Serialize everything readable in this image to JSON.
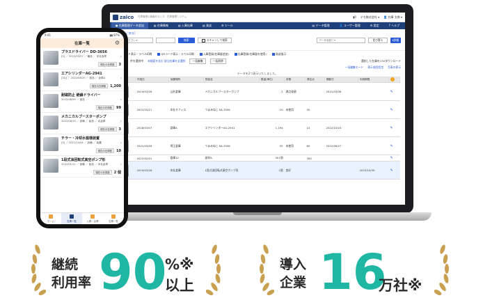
{
  "laptop": {
    "logo": "zaico",
    "header_sub": "在庫管理の無駄をなくす　在庫管理システム",
    "header_right": [
      "▮0",
      "デモ株式会社 ▾",
      "👤 在庫 太郎 ▾"
    ],
    "nav": [
      {
        "label": "● 在庫管理データ追加",
        "active": true
      },
      {
        "label": "▤ 在庫情報",
        "active": false
      },
      {
        "label": "▤ 入庫出庫",
        "active": false
      },
      {
        "label": "▤ 発送",
        "active": false
      },
      {
        "label": "⚙ ツール",
        "active": false
      }
    ],
    "nav_right": [
      {
        "label": "▤ データ管理"
      },
      {
        "label": "👤 ユーザー管理"
      },
      {
        "label": "⚙ 設定"
      },
      {
        "label": "? ヘルプ"
      }
    ],
    "back_link": "◂ [前画面に戻る]",
    "search_select_placeholder": "選択してください ▾",
    "search_button": "検索",
    "scan_button": "スキャンして検索",
    "data_select": "データ全部□ ▾",
    "detail_button": "▾詳細",
    "sort_button": "並び替え",
    "condition_link": "条件を追加",
    "tools": [
      {
        "label": "バーコード表示・ラベル印刷"
      },
      {
        "label": "QRコード表示・ラベル印刷"
      },
      {
        "label": "入庫登録(在庫量追加)"
      },
      {
        "label": "出庫登録(在庫量を使用)"
      },
      {
        "label": "発送指示"
      }
    ],
    "csv_label": "選択した在庫をCSVダウンロード",
    "selection": {
      "prefix": "選択",
      "count": "2",
      "suffix": "件を選択中",
      "select_all": "未検索を含む 該当在庫を全選択",
      "bulk_edit": "一括編集",
      "bulk_delete": "一括削除",
      "bulk_edit_mode": "一括編集モード",
      "display_items": "表示項目設定",
      "image_display": "写真の表示"
    },
    "notice": "データを2つ表示いたしました。",
    "table": {
      "headers": [
        "",
        "作成日",
        "保管場所",
        "物品名",
        "数量(単位)",
        "状態",
        "発注点",
        "棚卸日",
        "利用期限",
        ""
      ],
      "rows": [
        {
          "date": "2019/03/26",
          "place": "山形倉庫",
          "name": "メカニカルブースターポンプ",
          "qty": "2",
          "state": "満点発値",
          "reorder": "",
          "inv": "2021/03/06",
          "expire": "",
          "expire_red": false,
          "highlight": false
        },
        {
          "date": "2022/10/21",
          "place": "本社オフィス",
          "name": "つまみねじ SA-3556",
          "qty": "20",
          "state": "未使用",
          "reorder": "50",
          "inv": "",
          "expire": "",
          "expire_red": false,
          "highlight": false
        },
        {
          "date": "2018/03/07",
          "place": "倉庫A",
          "name": "エアシリンダーAG-2941",
          "qty": "1,194",
          "state": "",
          "reorder": "10",
          "inv": "2022/10/24",
          "expire": "",
          "expire_red": false,
          "highlight": false
        },
        {
          "date": "2021/03/09",
          "place": "埼玉倉庫",
          "name": "つまみねじ SA-3556",
          "qty": "55",
          "state": "未使用",
          "reorder": "60",
          "inv": "2022/09/27",
          "expire": "",
          "expire_red": false,
          "highlight": false
        },
        {
          "date": "2022/02/01",
          "place": "倉庫12",
          "name": "部材A",
          "qty": "301個",
          "state": "",
          "reorder": "300",
          "inv": "",
          "expire": "",
          "expire_red": false,
          "highlight": false,
          "small": true
        },
        {
          "date": "2019/03/26",
          "place": "本社倉庫",
          "name": "1段式油回転式真空ポンプ形",
          "qty": "1個",
          "state": "良好",
          "reorder": "",
          "inv": "",
          "expire": "2022/10/30",
          "expire_red": true,
          "highlight": true
        }
      ]
    }
  },
  "phone": {
    "status_time": "9:41",
    "status_right": "▮▮ 87%",
    "title": "在庫一覧",
    "items": [
      {
        "name": "プラスドライバー DD-3656",
        "meta": "[0] ／ 2022/03/27 ／ 備品 ／ 本社倉庫",
        "badge": "現在の在庫数",
        "qty": "3"
      },
      {
        "name": "エアシリンダーAG-2941",
        "meta": "[3Q] ／ 2022/08/25 ／ 部品 ／ 倉庫A",
        "badge": "現在の在庫数",
        "qty": "1,200"
      },
      {
        "name": "耐磁防止 絶縁ドライバー",
        "meta": "2022/08/09 ／ 部品",
        "badge": "現在の在庫数",
        "qty": "99"
      },
      {
        "name": "メカニカルブースターポンプ",
        "meta": "2022/08/19 ／ 設備 ／ 製品 ／ 北倉庫",
        "badge": "現在の在庫数",
        "qty": "3"
      },
      {
        "name": "チラー・冷却水循環装置",
        "meta": "[3] ／ 2021/10/04 ／ 設備 ／ 装置",
        "badge": "現在の在庫数",
        "qty": "10"
      },
      {
        "name": "1段式油回転式真空ポンプ形",
        "meta": "2022/01/11 ／ 設備 ／ 製品 ／ 本社倉庫",
        "badge": "現在の在庫数",
        "qty": "2 個"
      }
    ],
    "tabs": [
      {
        "label": "ホーム",
        "active": false
      },
      {
        "label": "在庫一覧",
        "active": true
      },
      {
        "label": "入庫・出庫",
        "active": false
      },
      {
        "label": "在庫一覧",
        "active": false
      }
    ]
  },
  "stats": [
    {
      "label_top": "継続",
      "label_bottom": "利用率",
      "value": "90",
      "unit_top": "%※",
      "unit_bottom": "以上"
    },
    {
      "label_top": "導入",
      "label_bottom": "企業",
      "value": "16",
      "unit": "万社※"
    }
  ],
  "colors": {
    "accent": "#1fb7a4",
    "brand": "#1f3f7a",
    "laurel": "#c9a050"
  }
}
